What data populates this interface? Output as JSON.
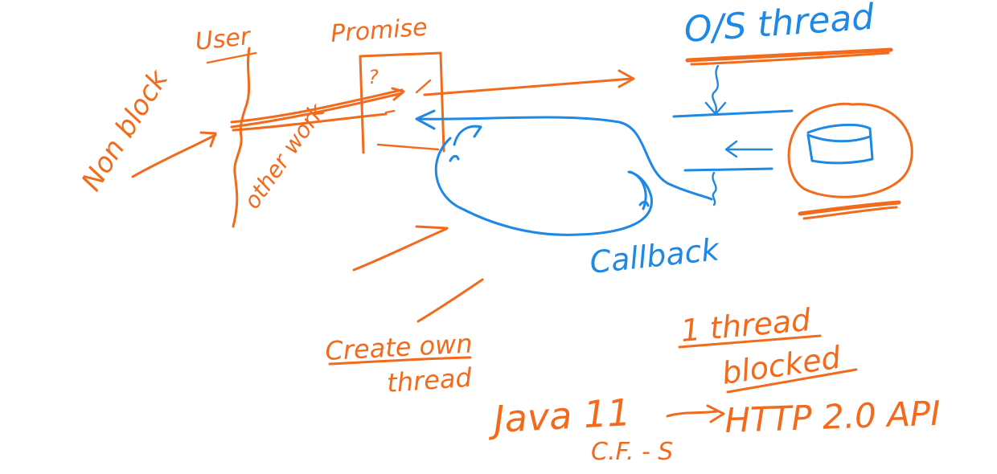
{
  "colors": {
    "orange": "#f26b1d",
    "blue": "#1e88e5",
    "background": "#ffffff"
  },
  "labels": {
    "user": "User",
    "promise": "Promise",
    "question_mark": "?",
    "non_blocking": "Non block",
    "other_work": "other work",
    "os_thread": "O/S thread",
    "callback": "Callback",
    "create_own_thread_line1": "Create own",
    "create_own_thread_line2": "thread",
    "one_thread_blocked_line1": "1 thread",
    "one_thread_blocked_line2": "blocked",
    "java11": "Java 11",
    "cf_s": "C.F. - S",
    "http_api": "HTTP 2.0 API"
  }
}
